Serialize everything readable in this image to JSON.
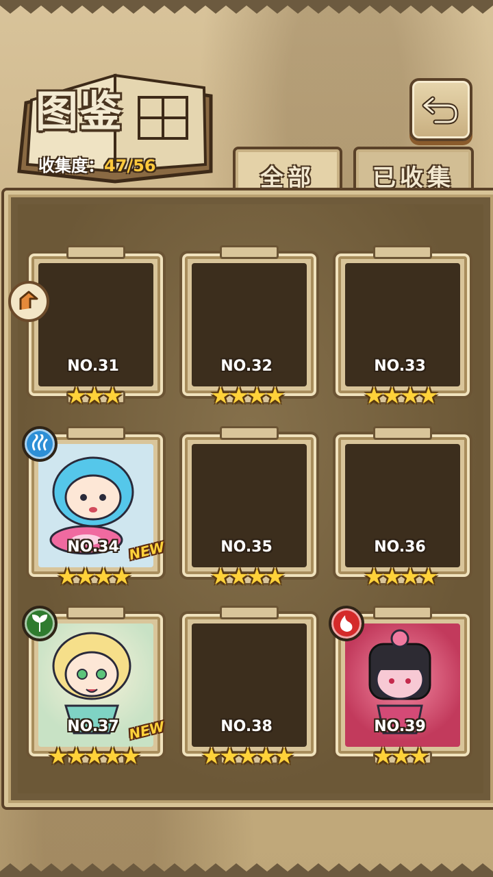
{
  "header": {
    "title": "图鉴",
    "collection_label": "收集度：",
    "collection_value": "47/56"
  },
  "tabs": [
    {
      "label": "全部",
      "selected": true
    },
    {
      "label": "已收集",
      "selected": false
    }
  ],
  "cards": [
    {
      "no": "NO.31",
      "stars": "★★★",
      "state": "locked"
    },
    {
      "no": "NO.32",
      "stars": "★★★★",
      "state": "locked"
    },
    {
      "no": "NO.33",
      "stars": "★★★★",
      "state": "locked"
    },
    {
      "no": "NO.34",
      "stars": "★★★★",
      "state": "collected",
      "element": "water-icon",
      "badge": "NEW"
    },
    {
      "no": "NO.35",
      "stars": "★★★★",
      "state": "locked"
    },
    {
      "no": "NO.36",
      "stars": "★★★★",
      "state": "locked"
    },
    {
      "no": "NO.37",
      "stars": "★★★★★",
      "state": "collected",
      "element": "leaf-icon",
      "badge": "NEW"
    },
    {
      "no": "NO.38",
      "stars": "★★★★★",
      "state": "locked"
    },
    {
      "no": "NO.39",
      "stars": "★★★",
      "state": "collected",
      "element": "fire-icon"
    }
  ],
  "colors": {
    "star": "#ffd23a",
    "water": "#2d8fd6",
    "wood": "#2f7b2f",
    "fire": "#d42a2a"
  }
}
